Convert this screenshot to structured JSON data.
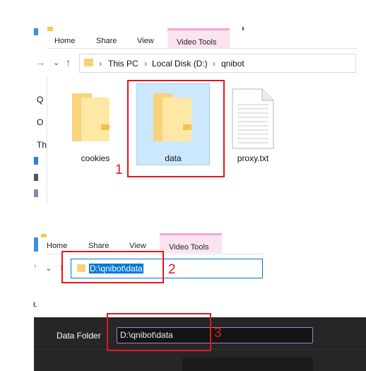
{
  "explorer_top": {
    "tabs": [
      "Home",
      "Share",
      "View",
      "Video Tools"
    ],
    "breadcrumb": [
      "This PC",
      "Local Disk (D:)",
      "qnibot"
    ],
    "sidebar_fragments": [
      "Q",
      "O",
      "Th"
    ],
    "files": [
      {
        "name": "cookies",
        "type": "folder-icon"
      },
      {
        "name": "data",
        "type": "folder-icon",
        "selected": true
      },
      {
        "name": "proxy.txt",
        "type": "text-file-icon"
      }
    ]
  },
  "explorer_bottom": {
    "tabs": [
      "Home",
      "Share",
      "View",
      "Video Tools"
    ],
    "address_value": "D:\\qnibot\\data"
  },
  "app_settings": {
    "data_folder_label": "Data Folder",
    "data_folder_value": "D:\\qnibot\\data"
  },
  "annotations": [
    "1",
    "2",
    "3"
  ],
  "colors": {
    "annotation": "#e3161b",
    "selection": "#cce8ff",
    "video_tools_tab": "#f3a7d2",
    "dark_panel": "#262626",
    "input_border": "#b07bd4"
  }
}
